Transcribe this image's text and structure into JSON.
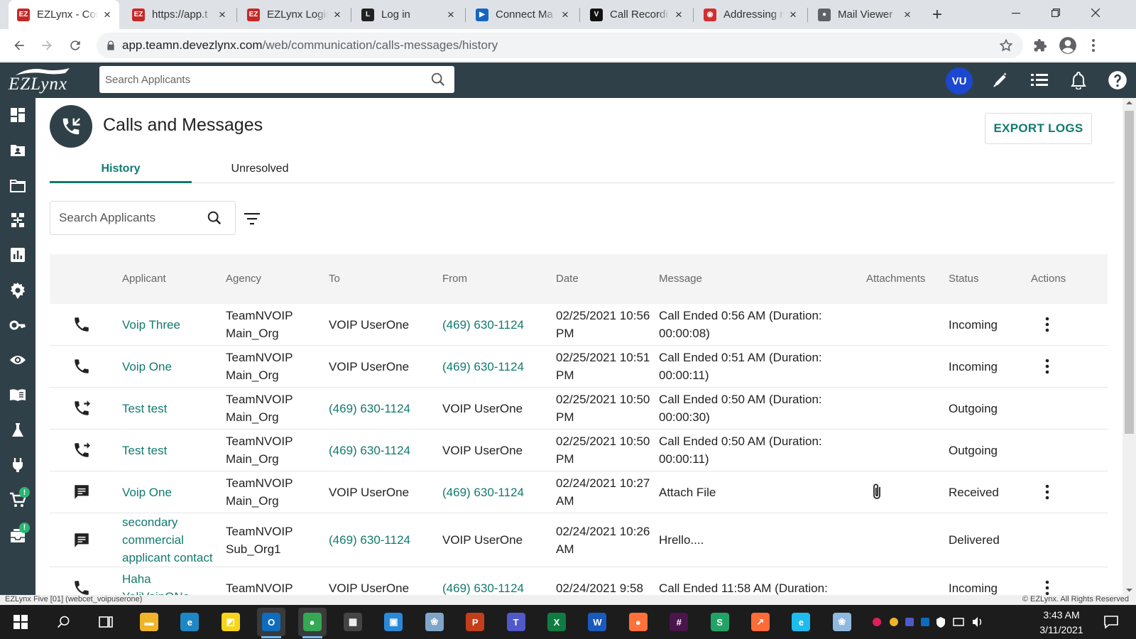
{
  "browser": {
    "tabs": [
      {
        "title": "EZLynx - Cor",
        "favicon": "EZ",
        "color": "#c62828",
        "active": true
      },
      {
        "title": "https://app.t",
        "favicon": "EZ",
        "color": "#c62828"
      },
      {
        "title": "EZLynx Login",
        "favicon": "EZ",
        "color": "#c62828"
      },
      {
        "title": "Log in",
        "favicon": "L",
        "color": "#222222"
      },
      {
        "title": "Connect Ma",
        "favicon": "▶",
        "color": "#1565c0"
      },
      {
        "title": "Call Recordi",
        "favicon": "V",
        "color": "#111111"
      },
      {
        "title": "Addressing r",
        "favicon": "◉",
        "color": "#d32f2f"
      },
      {
        "title": "Mail Viewer",
        "favicon": "●",
        "color": "#5f6368"
      }
    ],
    "new_tab": "+",
    "url_host": "app.teamn.devezlynx.com",
    "url_path": "/web/communication/calls-messages/history"
  },
  "app_header": {
    "logo": "EZLynx",
    "search_placeholder": "Search Applicants",
    "avatar_initials": "VU",
    "brand_color": "#304048",
    "accent_color": "#117a6e"
  },
  "sidebar": {
    "items": [
      {
        "icon": "dashboard-icon"
      },
      {
        "icon": "applicant-folder-icon"
      },
      {
        "icon": "folder-icon"
      },
      {
        "icon": "org-chart-icon"
      },
      {
        "icon": "reports-chart-icon"
      },
      {
        "icon": "settings-gear-icon"
      },
      {
        "icon": "key-icon"
      },
      {
        "icon": "eye-icon"
      },
      {
        "icon": "book-icon"
      },
      {
        "icon": "flask-icon"
      },
      {
        "icon": "plug-icon"
      },
      {
        "icon": "cart-icon",
        "badge": "!"
      },
      {
        "icon": "inbox-icon",
        "badge": "!"
      }
    ]
  },
  "page": {
    "title": "Calls and Messages",
    "tabs": [
      {
        "label": "History",
        "active": true
      },
      {
        "label": "Unresolved"
      }
    ],
    "search_placeholder": "Search Applicants",
    "export_label": "EXPORT LOGS"
  },
  "table": {
    "columns": [
      "Applicant",
      "Agency",
      "To",
      "From",
      "Date",
      "Message",
      "Attachments",
      "Status",
      "Actions"
    ],
    "rows": [
      {
        "type": "phone",
        "applicant": "Voip Three",
        "agency": "TeamNVOIP Main_Org",
        "to": "VOIP UserOne",
        "from": "(469) 630-1124",
        "date": "02/25/2021 10:56 PM",
        "message": "Call Ended 0:56 AM (Duration: 00:00:08)",
        "attachment": false,
        "status": "Incoming",
        "actions": true
      },
      {
        "type": "phone",
        "applicant": "Voip One",
        "agency": "TeamNVOIP Main_Org",
        "to": "VOIP UserOne",
        "from": "(469) 630-1124",
        "date": "02/25/2021 10:51 PM",
        "message": "Call Ended 0:51 AM (Duration: 00:00:11)",
        "attachment": false,
        "status": "Incoming",
        "actions": true
      },
      {
        "type": "outgoing",
        "applicant": "Test test",
        "agency": "TeamNVOIP Main_Org",
        "to": "(469) 630-1124",
        "from": "VOIP UserOne",
        "date": "02/25/2021 10:50 PM",
        "message": "Call Ended 0:50 AM (Duration: 00:00:30)",
        "attachment": false,
        "status": "Outgoing",
        "actions": false
      },
      {
        "type": "outgoing",
        "applicant": "Test test",
        "agency": "TeamNVOIP Main_Org",
        "to": "(469) 630-1124",
        "from": "VOIP UserOne",
        "date": "02/25/2021 10:50 PM",
        "message": "Call Ended 0:50 AM (Duration: 00:00:11)",
        "attachment": false,
        "status": "Outgoing",
        "actions": false
      },
      {
        "type": "message",
        "applicant": "Voip One",
        "agency": "TeamNVOIP Main_Org",
        "to": "VOIP UserOne",
        "from": "(469) 630-1124",
        "date": "02/24/2021 10:27 AM",
        "message": "Attach File",
        "attachment": true,
        "status": "Received",
        "actions": true
      },
      {
        "type": "message",
        "applicant": "secondary commercial applicant contact",
        "agency": "TeamNVOIP Sub_Org1",
        "to": "(469) 630-1124",
        "from": "VOIP UserOne",
        "date": "02/24/2021 10:26 AM",
        "message": "Hrello....",
        "attachment": false,
        "status": "Delivered",
        "actions": false
      },
      {
        "type": "phone",
        "applicant": "Haha YaliVoipONe",
        "agency": "TeamNVOIP",
        "to": "VOIP UserOne",
        "from": "(469) 630-1124",
        "date": "02/24/2021 9:58",
        "message": "Call Ended 11:58 AM (Duration:",
        "attachment": false,
        "status": "Incoming",
        "actions": true
      }
    ]
  },
  "status_bar": {
    "left": "EZLynx Five [01] (webcet_voipuserone)",
    "right": "© EZLynx. All Rights Reserved"
  },
  "taskbar": {
    "time": "3:43 AM",
    "date": "3/11/2021",
    "apps": [
      {
        "name": "file-explorer",
        "glyph": "▬",
        "color": "#f0b429"
      },
      {
        "name": "edge",
        "glyph": "e",
        "color": "#1e88c7"
      },
      {
        "name": "sticky-notes",
        "glyph": "◩",
        "color": "#f7d417"
      },
      {
        "name": "outlook",
        "glyph": "O",
        "color": "#0f6cbd",
        "active": true
      },
      {
        "name": "chrome",
        "glyph": "●",
        "color": "#34a853",
        "active": true
      },
      {
        "name": "calculator",
        "glyph": "▦",
        "color": "#444444"
      },
      {
        "name": "store",
        "glyph": "▣",
        "color": "#2b88d8"
      },
      {
        "name": "paint",
        "glyph": "❀",
        "color": "#7fa6c9"
      },
      {
        "name": "powerpoint",
        "glyph": "P",
        "color": "#c43e1c"
      },
      {
        "name": "teams",
        "glyph": "T",
        "color": "#5059c9"
      },
      {
        "name": "excel",
        "glyph": "X",
        "color": "#107c41"
      },
      {
        "name": "word",
        "glyph": "W",
        "color": "#185abd"
      },
      {
        "name": "firefox",
        "glyph": "●",
        "color": "#ff7139"
      },
      {
        "name": "slack",
        "glyph": "#",
        "color": "#4a154b"
      },
      {
        "name": "sheets",
        "glyph": "S",
        "color": "#21a366"
      },
      {
        "name": "postman",
        "glyph": "↗",
        "color": "#ff6c37"
      },
      {
        "name": "internet-explorer",
        "glyph": "e",
        "color": "#1ebbee"
      },
      {
        "name": "paint-3d",
        "glyph": "❀",
        "color": "#8fb9e0"
      }
    ]
  }
}
